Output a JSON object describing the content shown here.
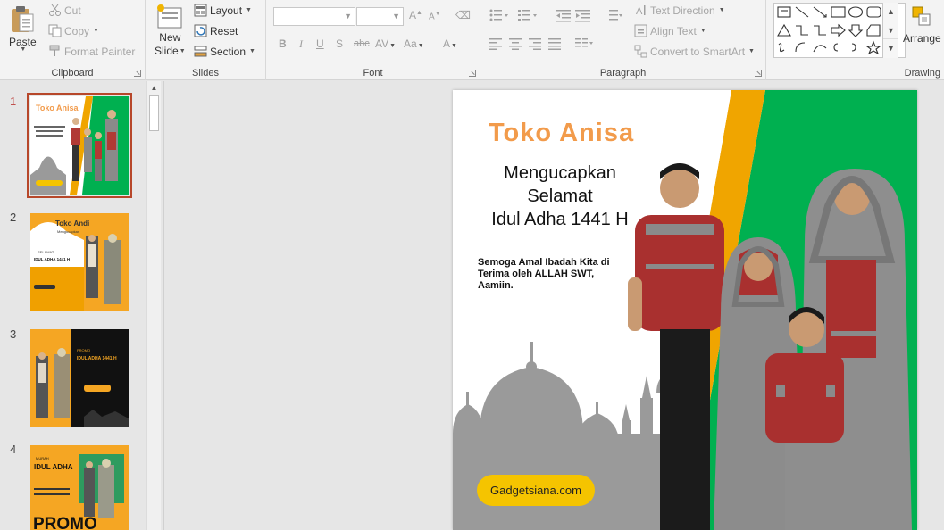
{
  "ribbon": {
    "clipboard": {
      "label": "Clipboard",
      "paste": "Paste",
      "cut": "Cut",
      "copy": "Copy",
      "format_painter": "Format Painter"
    },
    "slides": {
      "label": "Slides",
      "new_slide_line1": "New",
      "new_slide_line2": "Slide",
      "layout": "Layout",
      "reset": "Reset",
      "section": "Section"
    },
    "font": {
      "label": "Font",
      "bold": "B",
      "italic": "I",
      "underline": "U",
      "shadow": "S",
      "strikethrough": "abc",
      "spacing": "AV",
      "change_case": "Aa",
      "font_color": "A"
    },
    "paragraph": {
      "label": "Paragraph",
      "text_direction": "Text Direction",
      "align_text": "Align Text",
      "convert_smartart": "Convert to SmartArt"
    },
    "drawing": {
      "label": "Drawing",
      "arrange": "Arrange"
    }
  },
  "slide_pane": {
    "slides": [
      {
        "number": "1",
        "active": true
      },
      {
        "number": "2",
        "active": false
      },
      {
        "number": "3",
        "active": false
      },
      {
        "number": "4",
        "active": false
      }
    ],
    "thumb1": {
      "title": "Toko Anisa"
    },
    "thumb2": {
      "title": "Toko Andi",
      "subtitle": "Mengucapkan",
      "line": "SELAMAT",
      "headline": "IDUL ADHA 1441 H"
    },
    "thumb3": {
      "label": "PROMO",
      "headline": "IDUL ADHA 1441 H"
    },
    "thumb4": {
      "label": "MURAH",
      "headline": "IDUL ADHA",
      "promo": "PROMO"
    }
  },
  "slide": {
    "title": "Toko Anisa",
    "greeting": [
      "Mengucapkan",
      "Selamat",
      "Idul Adha 1441 H"
    ],
    "body": "Semoga Amal Ibadah Kita di Terima oleh ALLAH SWT, Aamiin.",
    "badge": "Gadgetsiana.com"
  },
  "colors": {
    "title_orange": "#f29b4b",
    "green": "#00b050",
    "stripe_orange": "#f0a500",
    "badge_yellow": "#f5c400",
    "mosque_gray": "#9a9a9a",
    "active_outline": "#b7472a"
  }
}
